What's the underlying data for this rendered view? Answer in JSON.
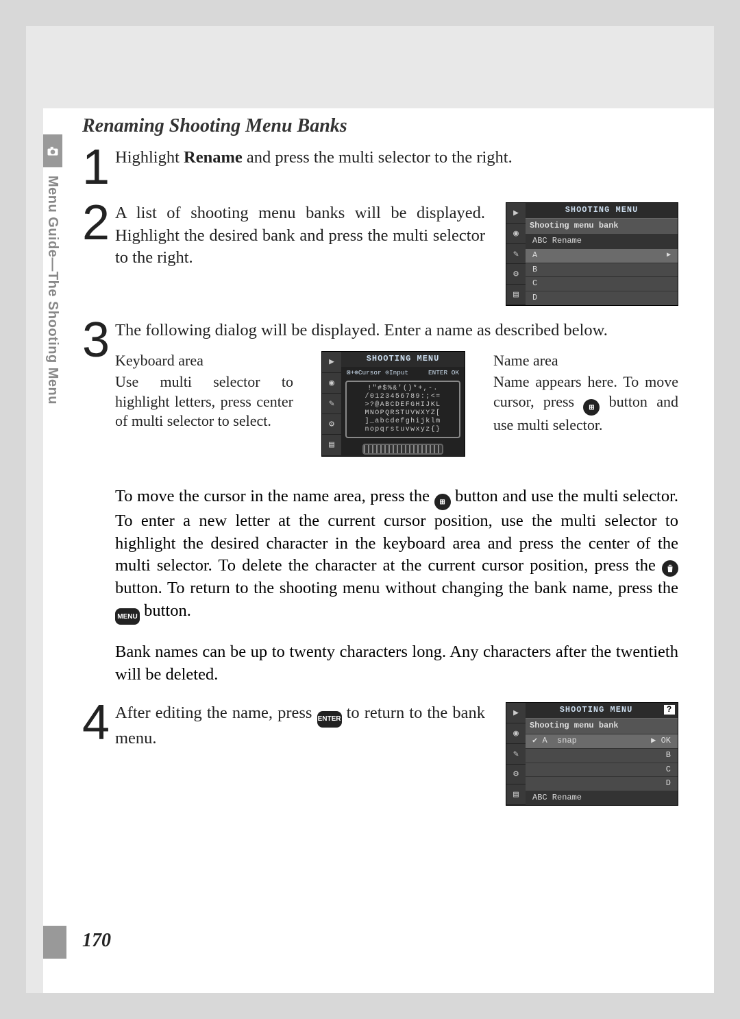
{
  "side_label": "Menu Guide—The Shooting Menu",
  "section_title": "Renaming Shooting Menu Banks",
  "step1": {
    "num": "1",
    "before": "Highlight ",
    "bold": "Rename",
    "after": " and press the multi selector to the right."
  },
  "step2": {
    "num": "2",
    "text": "A list of shooting menu banks will be dis­played.  Highlight the desired bank and press the multi selector to the right.",
    "lcd": {
      "title": "SHOOTING MENU",
      "sub": "Shooting menu bank",
      "rename": "ABC  Rename",
      "rows": [
        "A",
        "B",
        "C",
        "D"
      ]
    }
  },
  "step3": {
    "num": "3",
    "text": "The following dialog will be displayed.  Enter a name as described be­low.",
    "left_label": "Keyboard area",
    "left_text": "Use multi selector to highlight letters, press center of multi selector to select.",
    "right_label": "Name area",
    "right_text_1": "Name appears here.  To move cursor, press ",
    "right_text_2": " button and use multi selector.",
    "lcd": {
      "title": "SHOOTING MENU",
      "bar_left": "⊠+⊕Cursor ⊙Input",
      "bar_right": "ENTER OK",
      "kb_lines": [
        "!\"#$%&'()*+,-.",
        "/0123456789:;<=",
        ">?@ABCDEFGHIJKL",
        "MNOPQRSTUVWXYZ[",
        "]_abcdefghijklm",
        "nopqrstuvwxyz{}"
      ]
    }
  },
  "para1": {
    "t1": "To move the cursor in the name area, press the ",
    "t2": " button and use the multi selector.  To enter a new letter at the current cursor position, use the multi selector to highlight the desired character in the keyboard area and press the center of the multi selector.  To delete the character at the current cursor position, press the ",
    "t3": " button.  To return to the shooting menu without changing the bank name, press the ",
    "t4": " button."
  },
  "para2": "Bank names can be up to twenty characters long.  Any characters after the twentieth will be deleted.",
  "step4": {
    "num": "4",
    "t1": "After editing the name, press ",
    "t2": " to return to the bank menu.",
    "lcd": {
      "title": "SHOOTING MENU",
      "sub": "Shooting menu bank",
      "rows": [
        {
          "check": "✔",
          "letter": "A",
          "name": "snap",
          "ok": "▶ OK"
        },
        {
          "check": "",
          "letter": "B",
          "name": "",
          "ok": ""
        },
        {
          "check": "",
          "letter": "C",
          "name": "",
          "ok": ""
        },
        {
          "check": "",
          "letter": "D",
          "name": "",
          "ok": ""
        }
      ],
      "rename": "ABC  Rename"
    }
  },
  "icons": {
    "thumb": "⊕",
    "trash": "🗑",
    "menu": "MENU",
    "enter": "ENTER"
  },
  "page_number": "170"
}
